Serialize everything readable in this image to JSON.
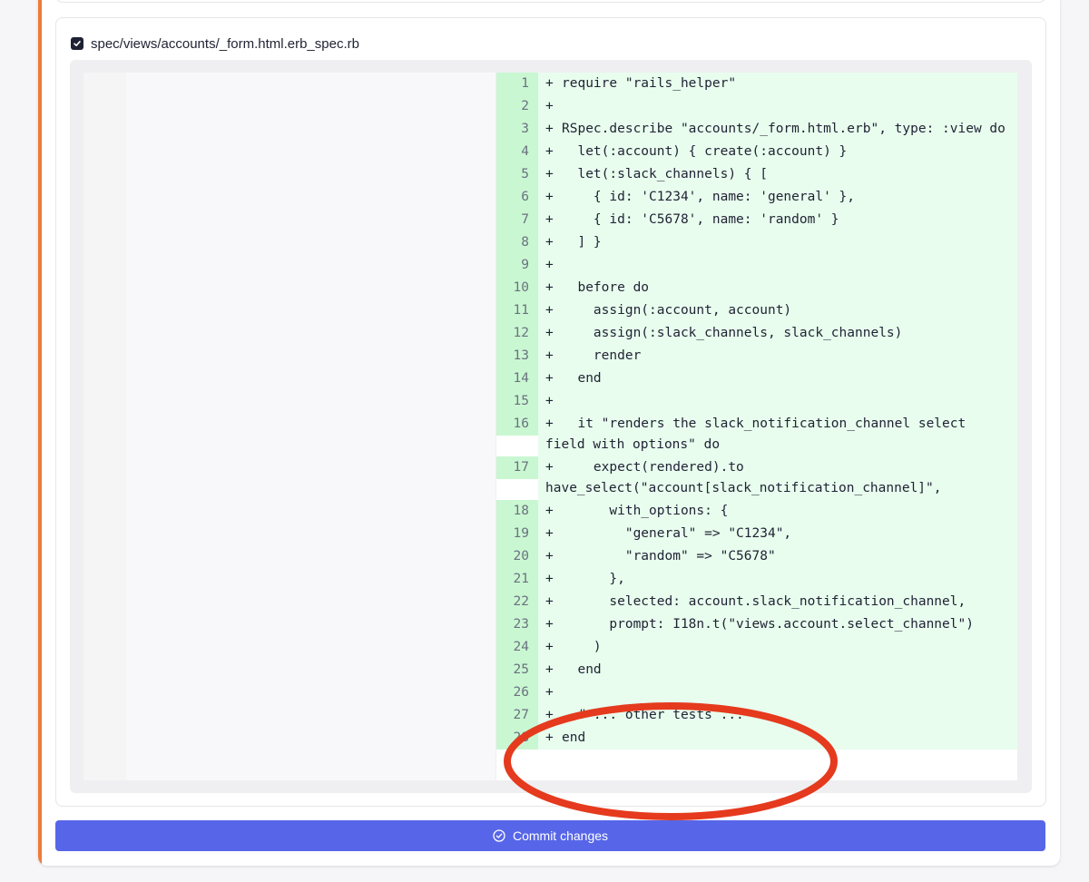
{
  "file": {
    "name": "spec/views/accounts/_form.html.erb_spec.rb",
    "checked": true
  },
  "diff": {
    "lines": [
      {
        "num": "1",
        "sign": "+",
        "text": "require \"rails_helper\""
      },
      {
        "num": "2",
        "sign": "+",
        "text": ""
      },
      {
        "num": "3",
        "sign": "+",
        "text": "RSpec.describe \"accounts/_form.html.erb\", type: :view do"
      },
      {
        "num": "4",
        "sign": "+",
        "text": "  let(:account) { create(:account) }"
      },
      {
        "num": "5",
        "sign": "+",
        "text": "  let(:slack_channels) { ["
      },
      {
        "num": "6",
        "sign": "+",
        "text": "    { id: 'C1234', name: 'general' },"
      },
      {
        "num": "7",
        "sign": "+",
        "text": "    { id: 'C5678', name: 'random' }"
      },
      {
        "num": "8",
        "sign": "+",
        "text": "  ] }"
      },
      {
        "num": "9",
        "sign": "+",
        "text": ""
      },
      {
        "num": "10",
        "sign": "+",
        "text": "  before do"
      },
      {
        "num": "11",
        "sign": "+",
        "text": "    assign(:account, account)"
      },
      {
        "num": "12",
        "sign": "+",
        "text": "    assign(:slack_channels, slack_channels)"
      },
      {
        "num": "13",
        "sign": "+",
        "text": "    render"
      },
      {
        "num": "14",
        "sign": "+",
        "text": "  end"
      },
      {
        "num": "15",
        "sign": "+",
        "text": ""
      },
      {
        "num": "16",
        "sign": "+",
        "text": "  it \"renders the slack_notification_channel select field with options\" do"
      },
      {
        "num": "17",
        "sign": "+",
        "text": "    expect(rendered).to have_select(\"account[slack_notification_channel]\","
      },
      {
        "num": "18",
        "sign": "+",
        "text": "      with_options: {"
      },
      {
        "num": "19",
        "sign": "+",
        "text": "        \"general\" => \"C1234\","
      },
      {
        "num": "20",
        "sign": "+",
        "text": "        \"random\" => \"C5678\""
      },
      {
        "num": "21",
        "sign": "+",
        "text": "      },"
      },
      {
        "num": "22",
        "sign": "+",
        "text": "      selected: account.slack_notification_channel,"
      },
      {
        "num": "23",
        "sign": "+",
        "text": "      prompt: I18n.t(\"views.account.select_channel\")"
      },
      {
        "num": "24",
        "sign": "+",
        "text": "    )"
      },
      {
        "num": "25",
        "sign": "+",
        "text": "  end"
      },
      {
        "num": "26",
        "sign": "+",
        "text": ""
      },
      {
        "num": "27",
        "sign": "+",
        "text": "  # ... other tests ..."
      },
      {
        "num": "28",
        "sign": "+",
        "text": "end"
      }
    ]
  },
  "actions": {
    "commit_label": "Commit changes"
  },
  "colors": {
    "accent": "#ee7b3b",
    "commit_button": "#5766e8",
    "added_line_bg": "#e8fdee",
    "added_gutter_bg": "#c9f7d2",
    "annotation": "#e53a1e"
  },
  "icons": {
    "checkbox": "check-icon",
    "commit": "check-circle-icon"
  }
}
